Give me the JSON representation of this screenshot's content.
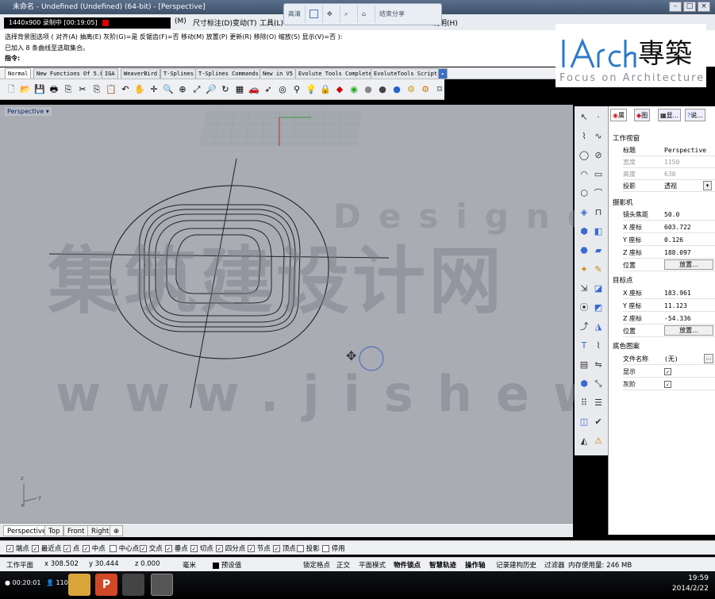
{
  "window": {
    "title": "未命名 - Undefined (Undefined) (64-bit) - [Perspective]",
    "recorder": "1440x900   录制中 [00:19:05]",
    "controls": [
      "–",
      "□",
      "×"
    ]
  },
  "menu": {
    "items": [
      "(M)",
      "尺寸标注(D)",
      "变动(T)",
      "工具(L)",
      "",
      "",
      "",
      "",
      "说明(H)"
    ]
  },
  "presentation_toolbar": {
    "items": [
      "高清",
      "",
      "",
      "",
      "",
      "结束分享"
    ]
  },
  "command": {
    "line1": "选择背景图选项 ( 对齐(A)  抽离(E)  灰阶(G)=是  反锯齿(F)=否  移动(M)  放置(P)  更新(R)  移除(O)  缩放(S)  显示(V)=否 ):",
    "line2": "已加入 8 条曲线至选取集合。",
    "prompt_label": "指令:",
    "prompt_value": ""
  },
  "logo": {
    "brand_latin": "lArch",
    "brand_cjk": "專築",
    "tagline": "Focus on Architecture"
  },
  "tabs": [
    "Normal",
    "New Functions Of 5.0",
    "IGA",
    "WeaverBird",
    "T-Splines",
    "T-Splines Commands",
    "New in V5",
    "Evolute Tools Complete",
    "EvoluteTools Scripts"
  ],
  "viewport": {
    "label": "Perspective",
    "axis_labels": {
      "z": "z",
      "y": "y",
      "x": "x"
    }
  },
  "watermark": {
    "main": "集筑建设计网",
    "url": "www.jishewu.com",
    "design": "Designer"
  },
  "properties": {
    "tabs": [
      "属",
      "图",
      "显...",
      "说..."
    ],
    "section_viewport": "工作视窗",
    "title_label": "标题",
    "title_value": "Perspective",
    "width_label": "宽度",
    "width_value": "1150",
    "height_label": "高度",
    "height_value": "630",
    "projection_label": "投影",
    "projection_value": "透视",
    "section_camera": "摄影机",
    "focal_label": "镜头焦距",
    "focal_value": "50.0",
    "cx_label": "X 座标",
    "cx_value": "603.722",
    "cy_label": "Y 座标",
    "cy_value": "0.126",
    "cz_label": "Z 座标",
    "cz_value": "188.097",
    "cpos_label": "位置",
    "place_button": "放置...",
    "section_target": "目标点",
    "tx_label": "X 座标",
    "tx_value": "183.961",
    "ty_label": "Y 座标",
    "ty_value": "11.123",
    "tz_label": "Z 座标",
    "tz_value": "-54.336",
    "tpos_label": "位置",
    "section_bg": "底色图案",
    "file_label": "文件名称",
    "file_value": "(无)",
    "show_label": "显示",
    "gray_label": "灰阶"
  },
  "viewport_tabs": [
    "Perspective",
    "Top",
    "Front",
    "Right",
    "⊕"
  ],
  "osnap": [
    {
      "label": "端点",
      "checked": true
    },
    {
      "label": "最近点",
      "checked": true
    },
    {
      "label": "点",
      "checked": true
    },
    {
      "label": "中点",
      "checked": true
    },
    {
      "label": "中心点",
      "checked": false
    },
    {
      "label": "交点",
      "checked": true
    },
    {
      "label": "垂点",
      "checked": true
    },
    {
      "label": "切点",
      "checked": true
    },
    {
      "label": "四分点",
      "checked": true
    },
    {
      "label": "节点",
      "checked": true
    },
    {
      "label": "顶点",
      "checked": true
    },
    {
      "label": "投影",
      "checked": false
    },
    {
      "label": "停用",
      "checked": false
    }
  ],
  "status": {
    "plane": "工作平面",
    "x": "x 308.502",
    "y": "y 30.444",
    "z": "z 0.000",
    "unit": "毫米",
    "layer": "预设值",
    "grid_snap": "锁定格点",
    "ortho": "正交",
    "planar": "平面模式",
    "osnap": "物件锁点",
    "smart": "智慧轨迹",
    "gumball": "操作轴",
    "history": "记录建构历史",
    "filter": "过滤器",
    "memory": "内存使用量: 246 MB"
  },
  "taskbar": {
    "timer": "00:20:01",
    "count": "110",
    "time": "19:59",
    "date": "2014/2/22"
  }
}
